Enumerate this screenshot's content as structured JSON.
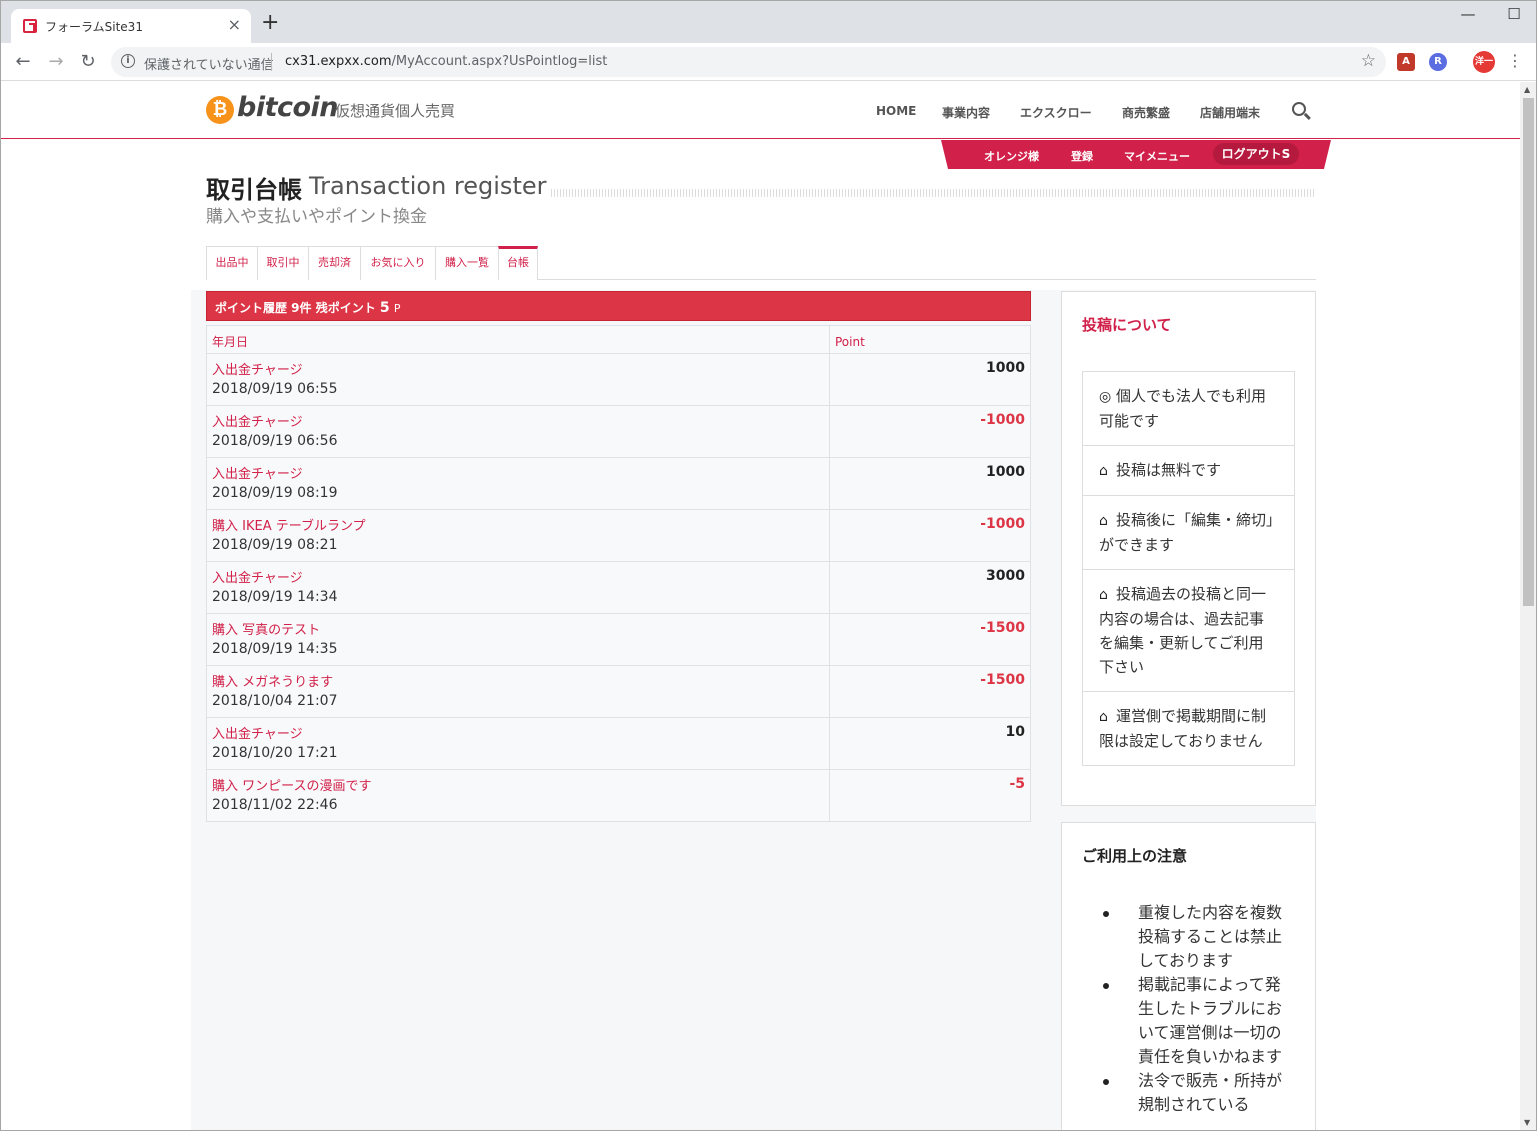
{
  "browser": {
    "tab_title": "フォーラムSite31",
    "security_text": "保護されていない通信",
    "url_host": "cx31.expxx.com",
    "url_path": "/MyAccount.aspx?UsPointlog=list",
    "profile_label": "洋一"
  },
  "site": {
    "logo_text": "bitcoin",
    "logo_sub": "仮想通貨個人売買",
    "nav": [
      "HOME",
      "事業内容",
      "エクスクロー",
      "商売繁盛",
      "店舗用端末"
    ],
    "user_nav": [
      "オレンジ様",
      "登録",
      "マイメニュー"
    ],
    "logout_label": "ログアウトS"
  },
  "page": {
    "title_jp": "取引台帳",
    "title_en": "Transaction register",
    "subtitle": "購入や支払いやポイント換金"
  },
  "tabs": [
    {
      "label": "出品中",
      "active": false
    },
    {
      "label": "取引中",
      "active": false
    },
    {
      "label": "売却済",
      "active": false
    },
    {
      "label": "お気に入り",
      "active": false
    },
    {
      "label": "購入一覧",
      "active": false
    },
    {
      "label": "台帳",
      "active": true
    }
  ],
  "history": {
    "header_prefix": "ポイント履歴 9件  残ポイント",
    "balance": "5",
    "unit": "P",
    "col_date": "年月日",
    "col_point": "Point",
    "rows": [
      {
        "title": "入出金チャージ",
        "date": "2018/09/19 06:55",
        "point": "1000"
      },
      {
        "title": "入出金チャージ",
        "date": "2018/09/19 06:56",
        "point": "-1000"
      },
      {
        "title": "入出金チャージ",
        "date": "2018/09/19 08:19",
        "point": "1000"
      },
      {
        "title": "購入 IKEA テーブルランプ",
        "date": "2018/09/19 08:21",
        "point": "-1000"
      },
      {
        "title": "入出金チャージ",
        "date": "2018/09/19 14:34",
        "point": "3000"
      },
      {
        "title": "購入 写真のテスト",
        "date": "2018/09/19 14:35",
        "point": "-1500"
      },
      {
        "title": "購入 メガネうります",
        "date": "2018/10/04 21:07",
        "point": "-1500"
      },
      {
        "title": "入出金チャージ",
        "date": "2018/10/20 17:21",
        "point": "10"
      },
      {
        "title": "購入 ワンピースの漫画です",
        "date": "2018/11/02 22:46",
        "point": "-5"
      }
    ]
  },
  "sidebar": {
    "about_title": "投稿について",
    "about_items": [
      {
        "icon": "target-icon",
        "text": "個人でも法人でも利用可能です"
      },
      {
        "icon": "home-icon",
        "text": "投稿は無料です"
      },
      {
        "icon": "home-icon",
        "text": "投稿後に「編集・締切」ができます"
      },
      {
        "icon": "home-icon",
        "text": "投稿過去の投稿と同一内容の場合は、過去記事を編集・更新してご利用下さい"
      },
      {
        "icon": "home-icon",
        "text": "運営側で掲載期間に制限は設定しておりません"
      }
    ],
    "caution_title": "ご利用上の注意",
    "caution_items": [
      "重複した内容を複数投稿することは禁止しております",
      "掲載記事によって発生したトラブルにおいて運営側は一切の責任を負いかねます",
      "法令で販売・所持が規制されている"
    ]
  },
  "colors": {
    "accent": "#d1214a",
    "negative": "#dc3545",
    "bitcoin": "#f7931a"
  }
}
